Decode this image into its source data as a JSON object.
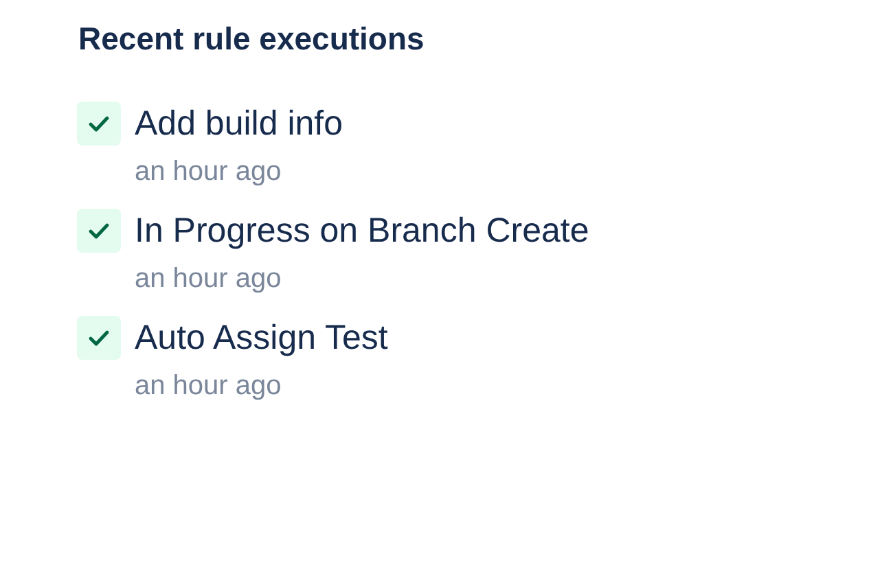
{
  "title": "Recent rule executions",
  "executions": [
    {
      "name": "Add build info",
      "time": "an hour ago",
      "succeeded": true
    },
    {
      "name": "In Progress on Branch Create",
      "time": "an hour ago",
      "succeeded": true
    },
    {
      "name": "Auto Assign Test",
      "time": "an hour ago",
      "succeeded": true
    }
  ]
}
